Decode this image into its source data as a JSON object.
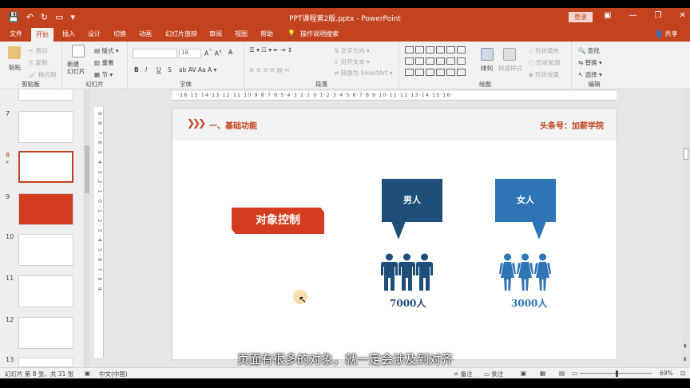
{
  "titlebar": {
    "title": "PPT课程第2版.pptx - PowerPoint",
    "login": "登录",
    "qa_icons": [
      "save-icon",
      "undo-icon",
      "redo-icon",
      "presentation-icon",
      "customize-icon"
    ]
  },
  "menu": {
    "tabs": [
      "文件",
      "开始",
      "插入",
      "设计",
      "切换",
      "动画",
      "幻灯片放映",
      "审阅",
      "视图",
      "帮助",
      "操作说明搜索"
    ],
    "active": "开始",
    "share": "共享"
  },
  "ribbon": {
    "clipboard": {
      "paste": "粘贴",
      "cut": "剪切",
      "copy": "复制",
      "format_painter": "格式刷",
      "label": "剪贴板"
    },
    "slides": {
      "new_slide": "新建\n幻灯片",
      "layout": "版式",
      "reset": "重置",
      "section": "节",
      "label": "幻灯片"
    },
    "font": {
      "font_size": "18",
      "bold": "B",
      "italic": "I",
      "underline": "U",
      "strike": "S",
      "label": "字体"
    },
    "paragraph": {
      "text_direction": "文字方向",
      "align_text": "对齐文本",
      "smartart": "转换为 SmartArt",
      "label": "段落"
    },
    "drawing": {
      "arrange": "排列",
      "quick_styles": "快速样式",
      "shape_fill": "形状填充",
      "shape_outline": "形状轮廓",
      "shape_effects": "形状效果",
      "label": "绘图"
    },
    "editing": {
      "find": "查找",
      "replace": "替换",
      "select": "选择",
      "label": "编辑"
    }
  },
  "thumbnails": [
    {
      "num": "7"
    },
    {
      "num": "8"
    },
    {
      "num": "9"
    },
    {
      "num": "10"
    },
    {
      "num": "11"
    },
    {
      "num": "12"
    },
    {
      "num": "13"
    }
  ],
  "rulers": {
    "horizontal": "·16·15·14·13·12·11·10·9·8·7·6·5·4·3·2·1·0·1·2·3·4·5·6·7·8·9·10·11·12·13·14·15·16·",
    "vertical": "9·8·7·6·5·4·3·2·1·0·1·2·3·4·5·6·7·8·9"
  },
  "slide": {
    "section_title": "一、基础功能",
    "brand": "头条号：加薪学院",
    "object_button": "对象控制",
    "male": {
      "label": "男人",
      "count": "7000人",
      "color": "#1f4e79"
    },
    "female": {
      "label": "女人",
      "count": "3000人",
      "color": "#2e75b6"
    },
    "accent": "#c3431f"
  },
  "subtitle": "页面有很多的对象，就一定会涉及到对齐",
  "statusbar": {
    "slide_info": "幻灯片 第 8 张，共 31 张",
    "language": "中文(中国)",
    "notes": "备注",
    "comments": "批注",
    "zoom": "69%"
  }
}
